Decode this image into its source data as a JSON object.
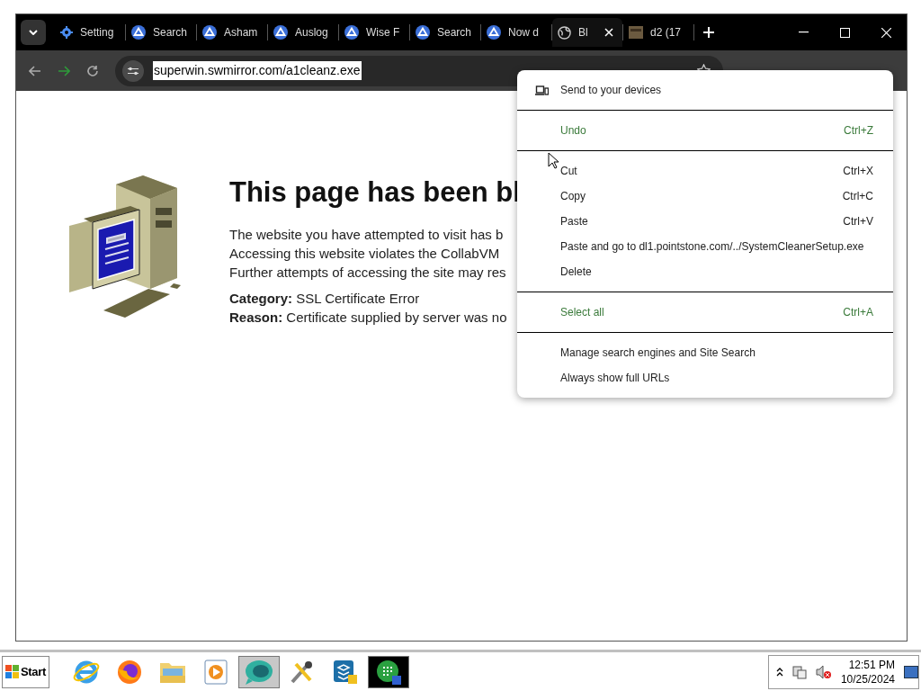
{
  "tabs": [
    {
      "kind": "settings",
      "label": "Setting",
      "selected": false
    },
    {
      "kind": "site",
      "label": "Search",
      "selected": false
    },
    {
      "kind": "site",
      "label": "Asham",
      "selected": false
    },
    {
      "kind": "site",
      "label": "Auslog",
      "selected": false
    },
    {
      "kind": "site",
      "label": "Wise F",
      "selected": false
    },
    {
      "kind": "site",
      "label": "Search",
      "selected": false
    },
    {
      "kind": "site",
      "label": "Now d",
      "selected": false
    },
    {
      "kind": "globe",
      "label": "Bl",
      "selected": true
    },
    {
      "kind": "thumbnail",
      "label": "d2 (17",
      "selected": false
    }
  ],
  "toolbar": {
    "url": "superwin.swmirror.com/a1cleanz.exe"
  },
  "page": {
    "heading": "This page has been bl",
    "lines": [
      "The website you have attempted to visit has b",
      "Accessing this website violates the CollabVM",
      "Further attempts of accessing the site may res"
    ],
    "facts": [
      {
        "label": "Category:",
        "value": "SSL Certificate Error"
      },
      {
        "label": "Reason:",
        "value": "Certificate supplied by server was no"
      }
    ]
  },
  "context_menu": {
    "groups": [
      [
        {
          "kind": "device",
          "label": "Send to your devices",
          "tinted": false
        }
      ],
      [
        {
          "kind": "item",
          "label": "Undo",
          "shortcut": "Ctrl+Z",
          "tinted": true
        }
      ],
      [
        {
          "kind": "item",
          "label": "Cut",
          "shortcut": "Ctrl+X",
          "tinted": false
        },
        {
          "kind": "item",
          "label": "Copy",
          "shortcut": "Ctrl+C",
          "tinted": false
        },
        {
          "kind": "item",
          "label": "Paste",
          "shortcut": "Ctrl+V",
          "tinted": false
        },
        {
          "kind": "item",
          "label": "Paste and go to dl1.pointstone.com/../SystemCleanerSetup.exe",
          "tinted": false
        },
        {
          "kind": "item",
          "label": "Delete",
          "tinted": false
        }
      ],
      [
        {
          "kind": "item",
          "label": "Select all",
          "shortcut": "Ctrl+A",
          "tinted": true
        }
      ],
      [
        {
          "kind": "item",
          "label": "Manage search engines and Site Search",
          "tinted": false
        },
        {
          "kind": "item",
          "label": "Always show full URLs",
          "tinted": false
        }
      ]
    ]
  },
  "taskbar": {
    "start": "Start",
    "apps": [
      {
        "kind": "ie",
        "selected": false
      },
      {
        "kind": "firefox",
        "selected": false
      },
      {
        "kind": "folder",
        "selected": false
      },
      {
        "kind": "media",
        "selected": false
      },
      {
        "kind": "bubble",
        "selected": true
      },
      {
        "kind": "tools",
        "selected": false
      },
      {
        "kind": "installer",
        "selected": false
      },
      {
        "kind": "grid",
        "selected": false
      }
    ],
    "time": "12:51 PM",
    "date": "10/25/2024"
  }
}
